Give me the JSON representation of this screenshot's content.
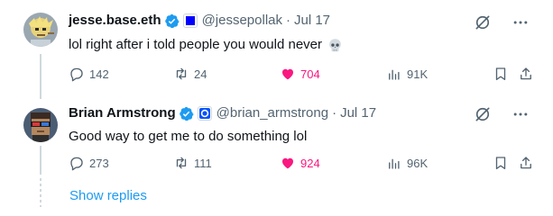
{
  "tweets": [
    {
      "name": "jesse.base.eth",
      "handle": "@jessepollak",
      "separator": "·",
      "date": "Jul 17",
      "text": "lol right after i told people you would never",
      "emoji_icon": "skull-emoji",
      "replies": "142",
      "reposts": "24",
      "likes": "704",
      "views": "91K",
      "liked": true
    },
    {
      "name": "Brian Armstrong",
      "handle": "@brian_armstrong",
      "separator": "·",
      "date": "Jul 17",
      "text": "Good way to get me to do something lol",
      "replies": "273",
      "reposts": "111",
      "likes": "924",
      "views": "96K",
      "liked": true
    }
  ],
  "show_replies": "Show replies",
  "colors": {
    "accent": "#1d9bf0",
    "like": "#f91880",
    "muted": "#536471",
    "text": "#0f1419",
    "affiliation_blue": "#0052ff"
  }
}
